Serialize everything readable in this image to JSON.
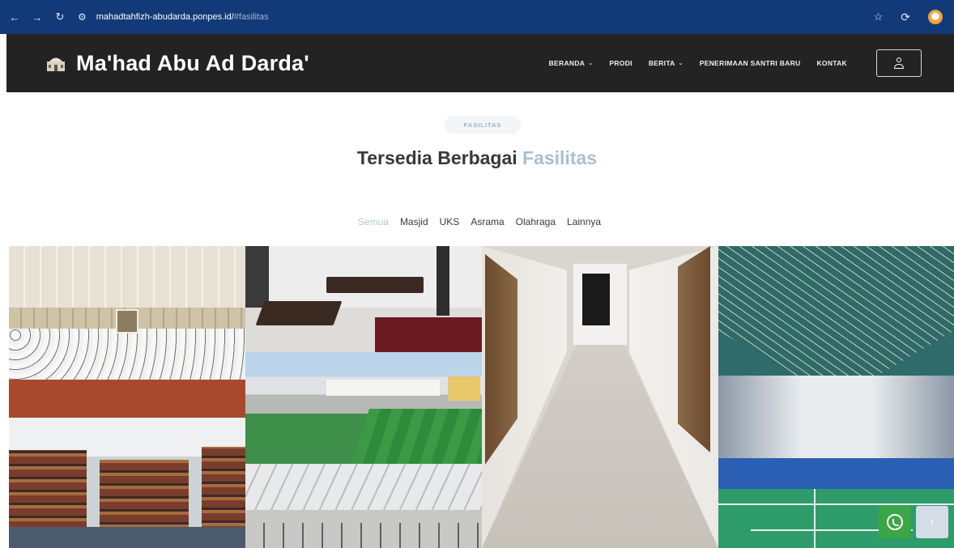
{
  "browser": {
    "url_host": "mahadtahfizh-abudarda.ponpes.id/",
    "url_path": "#fasilitas",
    "icons": {
      "back": "arrow-left-icon",
      "forward": "arrow-right-icon",
      "reload": "reload-icon",
      "site_info": "tune-icon",
      "bookmark": "star-icon",
      "extensions": "extension-icon",
      "profile": "profile-icon"
    }
  },
  "header": {
    "brand_title": "Ma'had Abu Ad Darda'",
    "brand_icon": "mosque-icon",
    "nav": [
      {
        "label": "BERANDA",
        "has_dropdown": true
      },
      {
        "label": "PRODI",
        "has_dropdown": false
      },
      {
        "label": "BERITA",
        "has_dropdown": true
      },
      {
        "label": "PENERIMAAN SANTRI BARU",
        "has_dropdown": false
      },
      {
        "label": "KONTAK",
        "has_dropdown": false
      }
    ],
    "account_icon": "user-icon",
    "background": "#232323"
  },
  "section": {
    "tag": "FASILITAS",
    "title_main": "Tersedia Berbagai ",
    "title_accent": "Fasilitas",
    "accent_color": "#a7c1cc"
  },
  "filters": [
    {
      "label": "Semua",
      "active": true
    },
    {
      "label": "Masjid",
      "active": false
    },
    {
      "label": "UKS",
      "active": false
    },
    {
      "label": "Asrama",
      "active": false
    },
    {
      "label": "Olahraga",
      "active": false
    },
    {
      "label": "Lainnya",
      "active": false
    }
  ],
  "floating": {
    "whatsapp_icon": "whatsapp-icon",
    "whatsapp_color": "#3aa645",
    "back_to_top_icon": "arrow-up-icon"
  }
}
